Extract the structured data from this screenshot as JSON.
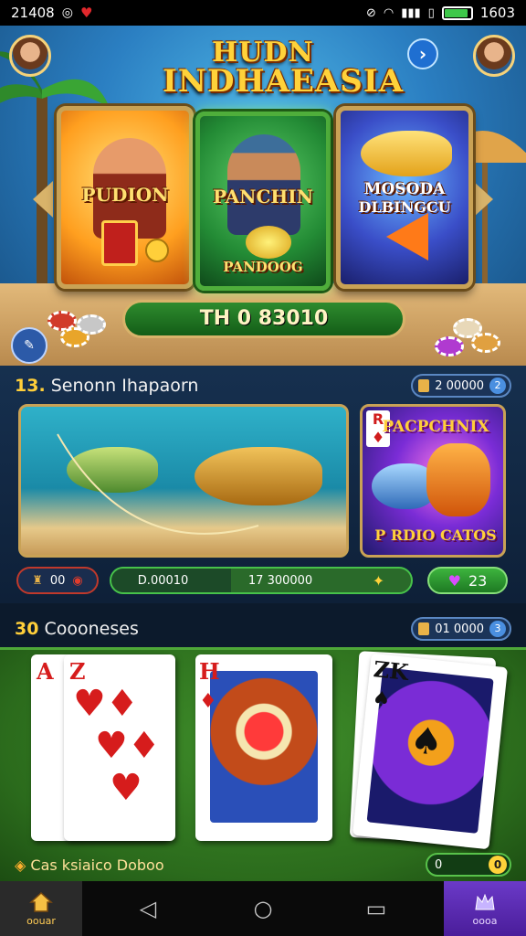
{
  "status_bar": {
    "time": "21408",
    "battery_text": "1603",
    "battery_level": 0.9,
    "icons": [
      "vpn-icon",
      "heart-icon",
      "mute-icon",
      "wifi-icon",
      "signal-icon",
      "sim-icon"
    ]
  },
  "hero": {
    "logo_line1": "HUDN",
    "logo_line2": "INDHAEASIA",
    "cards": [
      {
        "title": "PUDION"
      },
      {
        "title": "PANCHIN",
        "subtitle": "PANDOOG"
      },
      {
        "title": "MOSODA",
        "subtitle": "DLBINGCU"
      }
    ],
    "bar_text": "TH 0 83010"
  },
  "section1": {
    "number": "13.",
    "title": "Senonn Ihapaorn",
    "pill_text": "2 00000",
    "pill_badge": "2",
    "banner2_title": "PACPCHNIX",
    "banner2_rank": "R",
    "banner2_subtitle": "P RDIO CATOS"
  },
  "stats": {
    "left_value": "00",
    "mid_left": "D.00010",
    "mid_right": "17 300000",
    "right_value": "23"
  },
  "section2": {
    "number": "30",
    "title": "Coooneses",
    "pill_text": "01 0000",
    "pill_badge": "3"
  },
  "cards": [
    {
      "rank": "Z",
      "suit": "hearts"
    },
    {
      "rank": "H",
      "suit": "diamonds"
    },
    {
      "rank": "ZK",
      "suit": "spades"
    }
  ],
  "footer": {
    "label": "Cas ksiaico Doboo",
    "toggle_left": "0",
    "toggle_right": "0"
  },
  "nav": {
    "left_label": "oouar",
    "right_label": "oooa"
  },
  "colors": {
    "gold": "#ffd23a",
    "felt": "#2b6b1c",
    "accent_blue": "#1f6fd1"
  }
}
